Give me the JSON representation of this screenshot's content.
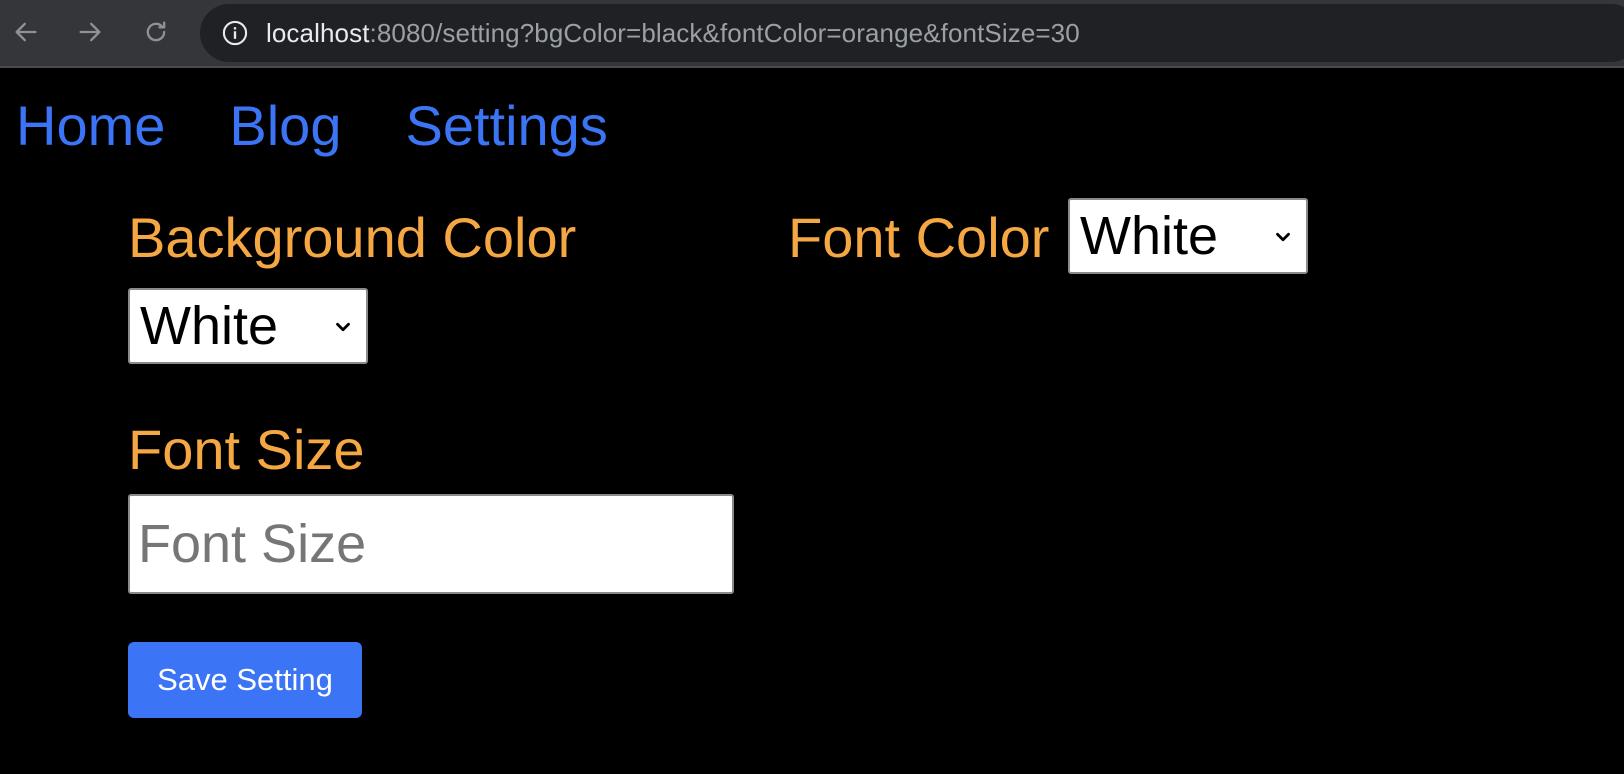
{
  "browser": {
    "url_host": "localhost",
    "url_rest": ":8080/setting?bgColor=black&fontColor=orange&fontSize=30",
    "icons": {
      "back": "arrow-left-icon",
      "forward": "arrow-right-icon",
      "reload": "reload-icon",
      "site_info": "info-icon"
    }
  },
  "nav": {
    "items": [
      {
        "label": "Home"
      },
      {
        "label": "Blog"
      },
      {
        "label": "Settings"
      }
    ]
  },
  "form": {
    "background_color": {
      "label": "Background Color",
      "selected": "White"
    },
    "font_color": {
      "label": "Font Color",
      "selected": "White"
    },
    "font_size": {
      "label": "Font Size",
      "value": "",
      "placeholder": "Font Size"
    },
    "save_label": "Save Setting"
  },
  "colors": {
    "page_background": "#000000",
    "link": "#3b74f5",
    "label": "#f4a742",
    "button": "#3b74f5"
  }
}
